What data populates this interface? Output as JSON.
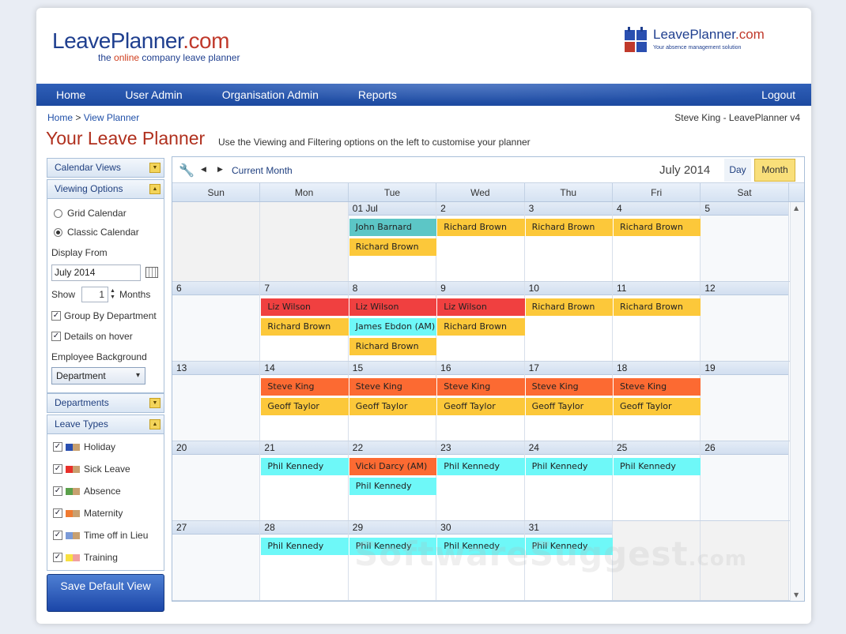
{
  "header": {
    "logo_title": "LeavePlanner",
    "logo_com": ".com",
    "logo_tag_pre": "the ",
    "logo_tag_online": "online",
    "logo_tag_post": " company leave planner",
    "right_logo_title": "LeavePlanner",
    "right_logo_com": ".com",
    "right_logo_tag": "Your absence management solution"
  },
  "nav": {
    "items": [
      "Home",
      "User Admin",
      "Organisation Admin",
      "Reports"
    ],
    "logout": "Logout"
  },
  "breadcrumb": {
    "home": "Home",
    "sep": " > ",
    "current": "View Planner"
  },
  "user_info": "Steve King - LeavePlanner v4",
  "page_title": "Your Leave Planner",
  "subtitle": "Use the Viewing and Filtering options on the left to customise your planner",
  "sidebar": {
    "calendar_views": "Calendar Views",
    "viewing_options": "Viewing Options",
    "grid_calendar": "Grid Calendar",
    "classic_calendar": "Classic Calendar",
    "display_from_label": "Display From",
    "display_from_value": "July 2014",
    "show_label": "Show",
    "show_value": "1",
    "months_label": "Months",
    "group_by_department": "Group By Department",
    "details_on_hover": "Details on hover",
    "employee_background_label": "Employee Background",
    "employee_background_value": "Department",
    "departments": "Departments",
    "leave_types": "Leave Types",
    "leave_type_items": [
      {
        "label": "Holiday",
        "c1": "#2a4fb0",
        "c2": "#c8a070"
      },
      {
        "label": "Sick Leave",
        "c1": "#e8302a",
        "c2": "#c8a070"
      },
      {
        "label": "Absence",
        "c1": "#5aa04a",
        "c2": "#c8a070"
      },
      {
        "label": "Maternity",
        "c1": "#f07a30",
        "c2": "#c8a070"
      },
      {
        "label": "Time off in Lieu",
        "c1": "#7a9ad8",
        "c2": "#c8a070"
      },
      {
        "label": "Training",
        "c1": "#f8e040",
        "c2": "#f0a0a0"
      }
    ],
    "save_button": "Save Default View"
  },
  "calendar": {
    "current_month_label": "Current Month",
    "month_title": "July 2014",
    "view_day": "Day",
    "view_month": "Month",
    "weekdays": [
      "Sun",
      "Mon",
      "Tue",
      "Wed",
      "Thu",
      "Fri",
      "Sat"
    ],
    "weeks": [
      [
        "",
        "",
        "01 Jul",
        "2",
        "3",
        "4",
        "5"
      ],
      [
        "6",
        "7",
        "8",
        "9",
        "10",
        "11",
        "12"
      ],
      [
        "13",
        "14",
        "15",
        "16",
        "17",
        "18",
        "19"
      ],
      [
        "20",
        "21",
        "22",
        "23",
        "24",
        "25",
        "26"
      ],
      [
        "27",
        "28",
        "29",
        "30",
        "31",
        "",
        ""
      ]
    ],
    "colors": {
      "gold": "#fcc83a",
      "teal": "#5cc6c6",
      "red": "#f04040",
      "orange": "#fc6a32",
      "cyan": "#6ef8f8"
    },
    "events": [
      {
        "week": 0,
        "day": 2,
        "row": 0,
        "span": 1,
        "name": "John Barnard",
        "color": "teal"
      },
      {
        "week": 0,
        "day": 3,
        "row": 0,
        "span": 1,
        "name": "Richard Brown",
        "color": "gold"
      },
      {
        "week": 0,
        "day": 4,
        "row": 0,
        "span": 1,
        "name": "Richard Brown",
        "color": "gold"
      },
      {
        "week": 0,
        "day": 5,
        "row": 0,
        "span": 1,
        "name": "Richard Brown",
        "color": "gold"
      },
      {
        "week": 0,
        "day": 2,
        "row": 1,
        "span": 1,
        "name": "Richard Brown",
        "color": "gold"
      },
      {
        "week": 1,
        "day": 1,
        "row": 0,
        "span": 1,
        "name": "Liz Wilson",
        "color": "red"
      },
      {
        "week": 1,
        "day": 2,
        "row": 0,
        "span": 1,
        "name": "Liz Wilson",
        "color": "red"
      },
      {
        "week": 1,
        "day": 3,
        "row": 0,
        "span": 1,
        "name": "Liz Wilson",
        "color": "red"
      },
      {
        "week": 1,
        "day": 4,
        "row": 0,
        "span": 1,
        "name": "Richard Brown",
        "color": "gold"
      },
      {
        "week": 1,
        "day": 5,
        "row": 0,
        "span": 1,
        "name": "Richard Brown",
        "color": "gold"
      },
      {
        "week": 1,
        "day": 1,
        "row": 1,
        "span": 1,
        "name": "Richard Brown",
        "color": "gold"
      },
      {
        "week": 1,
        "day": 2,
        "row": 1,
        "span": 1,
        "name": "James Ebdon (AM)",
        "color": "cyan"
      },
      {
        "week": 1,
        "day": 3,
        "row": 1,
        "span": 1,
        "name": "Richard Brown",
        "color": "gold"
      },
      {
        "week": 1,
        "day": 2,
        "row": 2,
        "span": 1,
        "name": "Richard Brown",
        "color": "gold"
      },
      {
        "week": 2,
        "day": 1,
        "row": 0,
        "span": 1,
        "name": "Steve King",
        "color": "orange"
      },
      {
        "week": 2,
        "day": 2,
        "row": 0,
        "span": 1,
        "name": "Steve King",
        "color": "orange"
      },
      {
        "week": 2,
        "day": 3,
        "row": 0,
        "span": 1,
        "name": "Steve King",
        "color": "orange"
      },
      {
        "week": 2,
        "day": 4,
        "row": 0,
        "span": 1,
        "name": "Steve King",
        "color": "orange"
      },
      {
        "week": 2,
        "day": 5,
        "row": 0,
        "span": 1,
        "name": "Steve King",
        "color": "orange"
      },
      {
        "week": 2,
        "day": 1,
        "row": 1,
        "span": 1,
        "name": "Geoff Taylor",
        "color": "gold"
      },
      {
        "week": 2,
        "day": 2,
        "row": 1,
        "span": 1,
        "name": "Geoff Taylor",
        "color": "gold"
      },
      {
        "week": 2,
        "day": 3,
        "row": 1,
        "span": 1,
        "name": "Geoff Taylor",
        "color": "gold"
      },
      {
        "week": 2,
        "day": 4,
        "row": 1,
        "span": 1,
        "name": "Geoff Taylor",
        "color": "gold"
      },
      {
        "week": 2,
        "day": 5,
        "row": 1,
        "span": 1,
        "name": "Geoff Taylor",
        "color": "gold"
      },
      {
        "week": 3,
        "day": 1,
        "row": 0,
        "span": 1,
        "name": "Phil Kennedy",
        "color": "cyan"
      },
      {
        "week": 3,
        "day": 2,
        "row": 0,
        "span": 1,
        "name": "Vicki Darcy (AM)",
        "color": "orange"
      },
      {
        "week": 3,
        "day": 3,
        "row": 0,
        "span": 1,
        "name": "Phil Kennedy",
        "color": "cyan"
      },
      {
        "week": 3,
        "day": 4,
        "row": 0,
        "span": 1,
        "name": "Phil Kennedy",
        "color": "cyan"
      },
      {
        "week": 3,
        "day": 5,
        "row": 0,
        "span": 1,
        "name": "Phil Kennedy",
        "color": "cyan"
      },
      {
        "week": 3,
        "day": 2,
        "row": 1,
        "span": 1,
        "name": "Phil Kennedy",
        "color": "cyan"
      },
      {
        "week": 4,
        "day": 1,
        "row": 0,
        "span": 1,
        "name": "Phil Kennedy",
        "color": "cyan"
      },
      {
        "week": 4,
        "day": 2,
        "row": 0,
        "span": 1,
        "name": "Phil Kennedy",
        "color": "cyan"
      },
      {
        "week": 4,
        "day": 3,
        "row": 0,
        "span": 1,
        "name": "Phil Kennedy",
        "color": "cyan"
      },
      {
        "week": 4,
        "day": 4,
        "row": 0,
        "span": 1,
        "name": "Phil Kennedy",
        "color": "cyan"
      }
    ]
  },
  "watermark": {
    "main": "SoftwareSuggest",
    "suffix": ".com"
  }
}
